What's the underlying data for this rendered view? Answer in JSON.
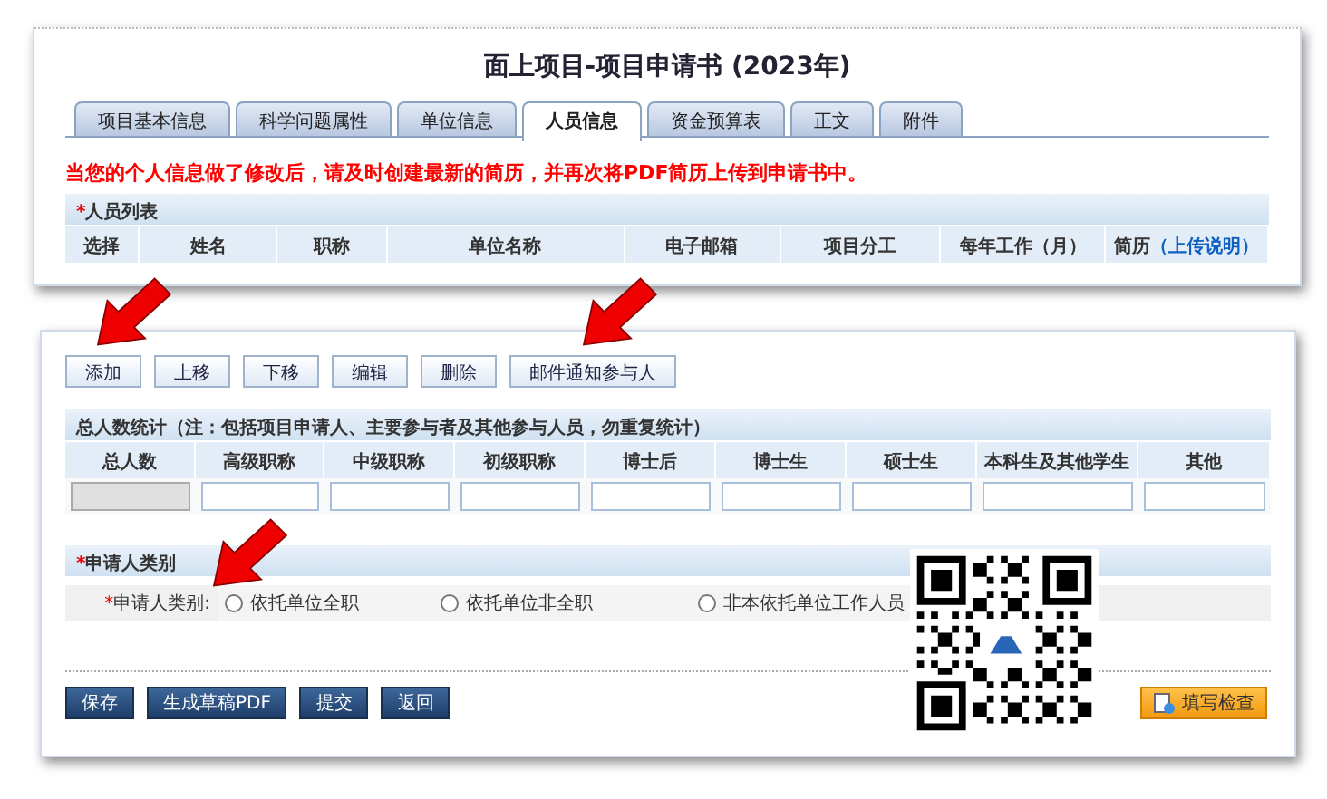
{
  "title": "面上项目-项目申请书 (2023年)",
  "tabs": [
    {
      "label": "项目基本信息",
      "selected": false
    },
    {
      "label": "科学问题属性",
      "selected": false
    },
    {
      "label": "单位信息",
      "selected": false
    },
    {
      "label": "人员信息",
      "selected": true
    },
    {
      "label": "资金预算表",
      "selected": false
    },
    {
      "label": "正文",
      "selected": false
    },
    {
      "label": "附件",
      "selected": false
    }
  ],
  "notice": "当您的个人信息做了修改后，请及时创建最新的简历，并再次将PDF简历上传到申请书中。",
  "personnel_list": {
    "title": "人员列表",
    "required_mark": "*",
    "columns": [
      {
        "label": "选择"
      },
      {
        "label": "姓名"
      },
      {
        "label": "职称"
      },
      {
        "label": "单位名称"
      },
      {
        "label": "电子邮箱"
      },
      {
        "label": "项目分工"
      },
      {
        "label": "每年工作（月）"
      },
      {
        "label": "简历",
        "link": "（上传说明）"
      }
    ]
  },
  "toolbar": [
    "添加",
    "上移",
    "下移",
    "编辑",
    "删除",
    "邮件通知参与人"
  ],
  "stats": {
    "title": "总人数统计（注：包括项目申请人、主要参与者及其他参与人员，勿重复统计）",
    "columns": [
      {
        "label": "总人数",
        "disabled": true
      },
      {
        "label": "高级职称",
        "disabled": false
      },
      {
        "label": "中级职称",
        "disabled": false
      },
      {
        "label": "初级职称",
        "disabled": false
      },
      {
        "label": "博士后",
        "disabled": false
      },
      {
        "label": "博士生",
        "disabled": false
      },
      {
        "label": "硕士生",
        "disabled": false
      },
      {
        "label": "本科生及其他学生",
        "disabled": false
      },
      {
        "label": "其他",
        "disabled": false
      }
    ]
  },
  "applicant_type": {
    "title": "申请人类别",
    "required_mark": "*",
    "label_mark": "*",
    "label": "申请人类别:",
    "options": [
      {
        "label": "依托单位全职",
        "selected": false
      },
      {
        "label": "依托单位非全职",
        "selected": false
      },
      {
        "label": "非本依托单位工作人员",
        "selected": false
      }
    ]
  },
  "actions": [
    "保存",
    "生成草稿PDF",
    "提交",
    "返回"
  ],
  "check_button": "填写检查"
}
